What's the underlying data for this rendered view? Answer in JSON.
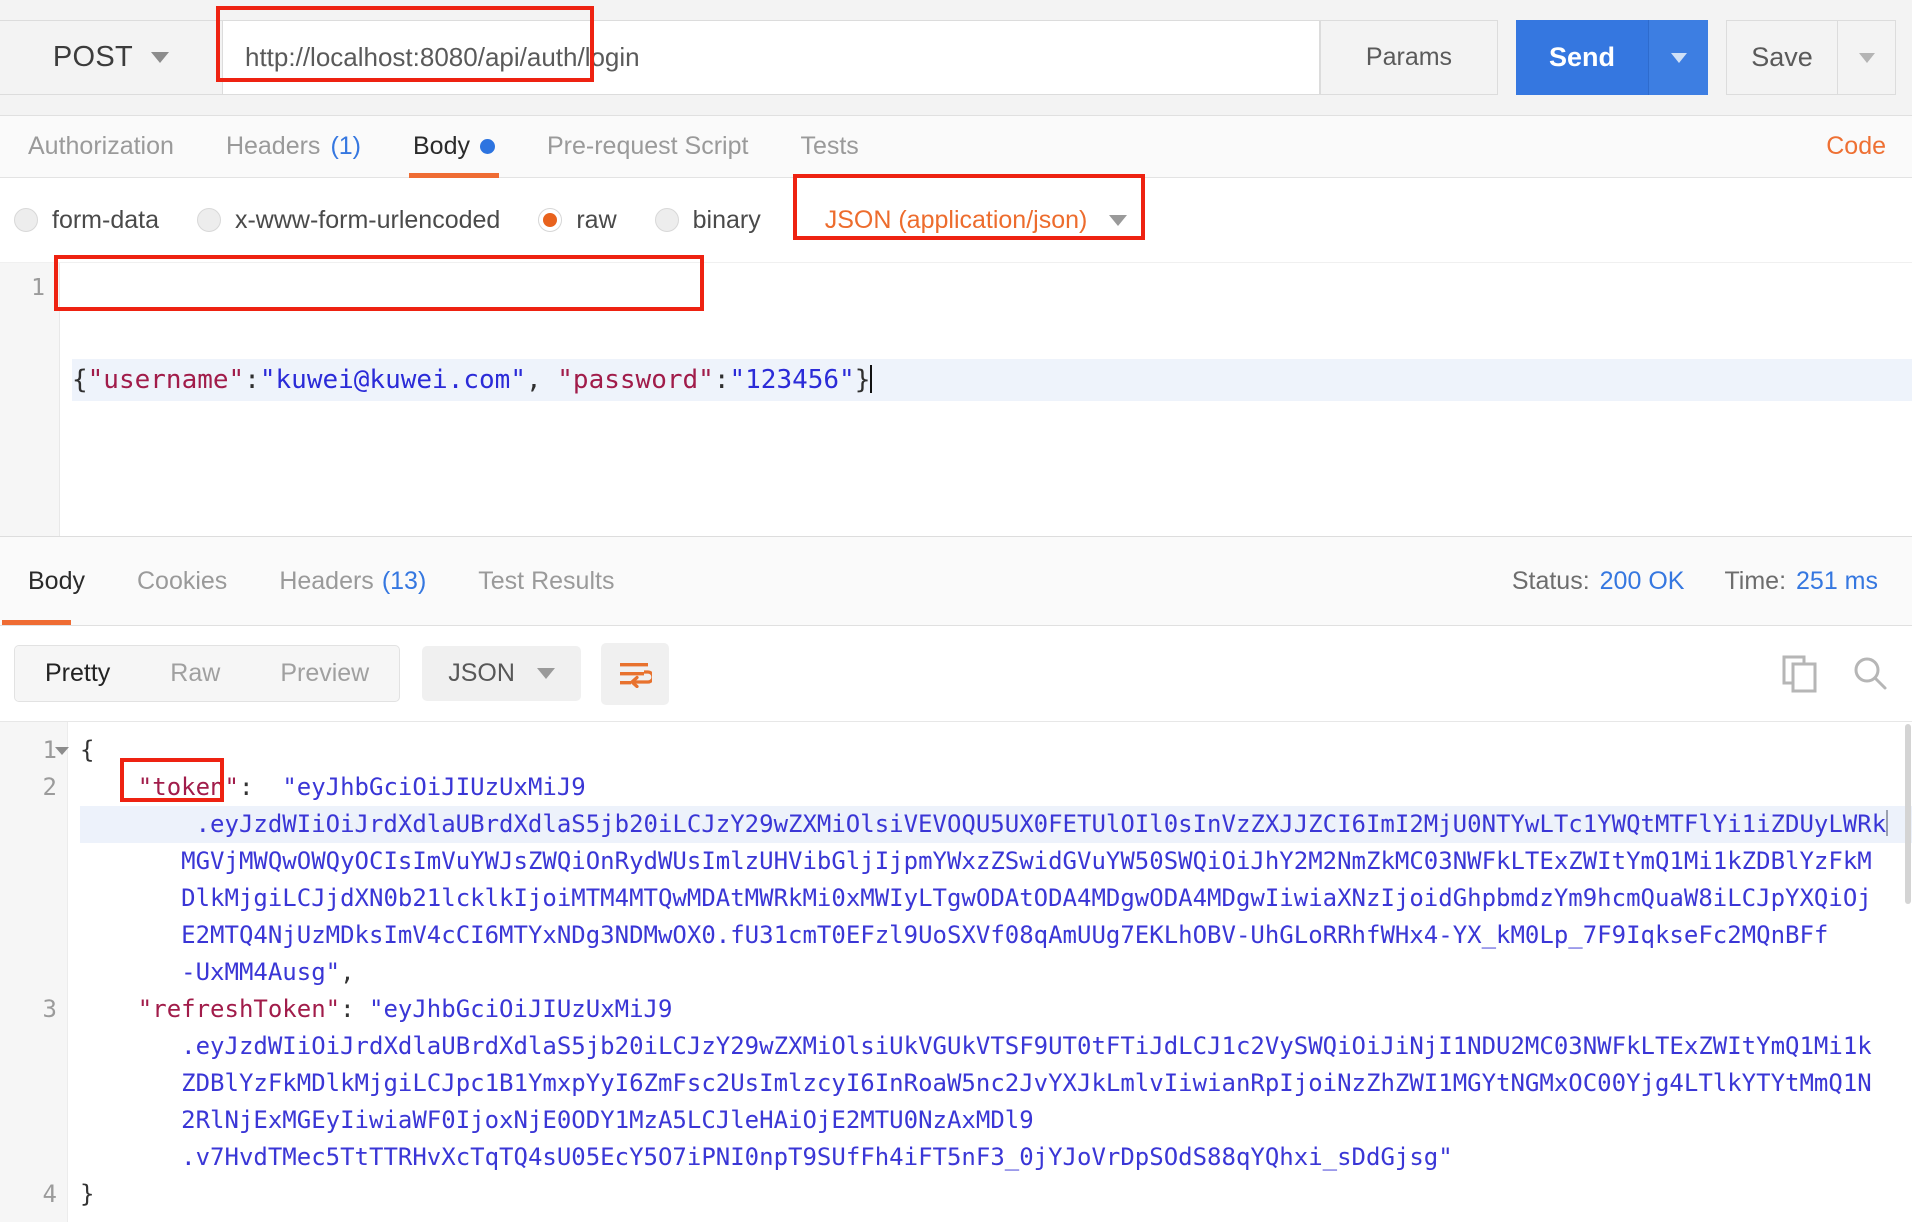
{
  "request": {
    "method": "POST",
    "url": "http://localhost:8080/api/auth/login",
    "params_label": "Params",
    "send_label": "Send",
    "save_label": "Save",
    "tabs": [
      {
        "label": "Authorization",
        "count": "",
        "active": false,
        "dot": false
      },
      {
        "label": "Headers",
        "count": "(1)",
        "active": false,
        "dot": false
      },
      {
        "label": "Body",
        "count": "",
        "active": true,
        "dot": true
      },
      {
        "label": "Pre-request Script",
        "count": "",
        "active": false,
        "dot": false
      },
      {
        "label": "Tests",
        "count": "",
        "active": false,
        "dot": false
      }
    ],
    "code_link": "Code",
    "body_types": [
      {
        "label": "form-data",
        "selected": false
      },
      {
        "label": "x-www-form-urlencoded",
        "selected": false
      },
      {
        "label": "raw",
        "selected": true
      },
      {
        "label": "binary",
        "selected": false
      }
    ],
    "content_type": "JSON (application/json)",
    "editor": {
      "line_number": "1",
      "open_brace": "{",
      "key_username": "\"username\"",
      "colon1": ":",
      "val_username": "\"kuwei@kuwei.com\"",
      "comma": ", ",
      "key_password": "\"password\"",
      "colon2": ":",
      "val_password": "\"123456\"",
      "close_brace": "}"
    }
  },
  "response": {
    "tabs": [
      {
        "label": "Body",
        "count": "",
        "active": true
      },
      {
        "label": "Cookies",
        "count": "",
        "active": false
      },
      {
        "label": "Headers",
        "count": "(13)",
        "active": false
      },
      {
        "label": "Test Results",
        "count": "",
        "active": false
      }
    ],
    "status_label": "Status:",
    "status_value": "200 OK",
    "time_label": "Time:",
    "time_value": "251 ms",
    "view_modes": [
      {
        "label": "Pretty",
        "active": true
      },
      {
        "label": "Raw",
        "active": false
      },
      {
        "label": "Preview",
        "active": false
      }
    ],
    "format": "JSON",
    "wrap_icon": "word-wrap-icon",
    "copy_icon": "copy-icon",
    "search_icon": "search-icon",
    "gutter": [
      "1",
      "2",
      "",
      "",
      "",
      "",
      "",
      "3",
      "",
      "",
      "",
      "",
      "4"
    ],
    "lines": [
      {
        "n": "1",
        "fold": true,
        "segments": [
          {
            "t": "punc",
            "v": "{"
          }
        ]
      },
      {
        "n": "2",
        "fold": false,
        "segments": [
          {
            "t": "indent",
            "v": "    "
          },
          {
            "t": "key",
            "v": "\"token\""
          },
          {
            "t": "punc",
            "v": ":"
          },
          {
            "t": "indent",
            "v": "  "
          },
          {
            "t": "str",
            "v": "\"eyJhbGciOiJIUzUxMiJ9"
          }
        ]
      },
      {
        "n": "",
        "fold": false,
        "selected": true,
        "segments": [
          {
            "t": "indent",
            "v": "        "
          },
          {
            "t": "str",
            "v": ".eyJzdWIiOiJrdXdlaUBrdXdlaS5jb20iLCJzY29wZXMiOlsiVEVOQU5UX0FETUlOIl0sInVzZXJJZCI6ImI2MjU0NTYwLTc1YWQtMTFlYi1iZDUyLWRk"
          },
          {
            "t": "caret",
            "v": ""
          }
        ]
      },
      {
        "n": "",
        "fold": false,
        "segments": [
          {
            "t": "indent",
            "v": "       "
          },
          {
            "t": "str",
            "v": "MGVjMWQwOWQyOCIsImVuYWJsZWQiOnRydWUsImlzUHVibGljIjpmYWxzZSwidGVuYW50SWQiOiJhY2M2NmZkMC03NWFkLTExZWItYmQ1Mi1kZDBlYzFkM"
          }
        ]
      },
      {
        "n": "",
        "fold": false,
        "segments": [
          {
            "t": "indent",
            "v": "       "
          },
          {
            "t": "str",
            "v": "DlkMjgiLCJjdXN0b21lcklkIjoiMTM4MTQwMDAtMWRkMi0xMWIyLTgwODAtODA4MDgwODA4MDgwIiwiaXNzIjoidGhpbmdzYm9hcmQuaW8iLCJpYXQiOj"
          }
        ]
      },
      {
        "n": "",
        "fold": false,
        "segments": [
          {
            "t": "indent",
            "v": "       "
          },
          {
            "t": "str",
            "v": "E2MTQ4NjUzMDksImV4cCI6MTYxNDg3NDMwOX0.fU31cmT0EFzl9UoSXVf08qAmUUg7EKLhOBV-UhGLoRRhfWHx4-YX_kM0Lp_7F9IqkseFc2MQnBFf"
          }
        ]
      },
      {
        "n": "",
        "fold": false,
        "segments": [
          {
            "t": "indent",
            "v": "       "
          },
          {
            "t": "str",
            "v": "-UxMM4Ausg\""
          },
          {
            "t": "punc",
            "v": ","
          }
        ]
      },
      {
        "n": "3",
        "fold": false,
        "segments": [
          {
            "t": "indent",
            "v": "    "
          },
          {
            "t": "key",
            "v": "\"refreshToken\""
          },
          {
            "t": "punc",
            "v": ":"
          },
          {
            "t": "indent",
            "v": " "
          },
          {
            "t": "str",
            "v": "\"eyJhbGciOiJIUzUxMiJ9"
          }
        ]
      },
      {
        "n": "",
        "fold": false,
        "segments": [
          {
            "t": "indent",
            "v": "       "
          },
          {
            "t": "str",
            "v": ".eyJzdWIiOiJrdXdlaUBrdXdlaS5jb20iLCJzY29wZXMiOlsiUkVGUkVTSF9UT0tFTiJdLCJ1c2VySWQiOiJiNjI1NDU2MC03NWFkLTExZWItYmQ1Mi1k"
          }
        ]
      },
      {
        "n": "",
        "fold": false,
        "segments": [
          {
            "t": "indent",
            "v": "       "
          },
          {
            "t": "str",
            "v": "ZDBlYzFkMDlkMjgiLCJpc1B1YmxpYyI6ZmFsc2UsImlzcyI6InRoaW5nc2JvYXJkLmlvIiwianRpIjoiNzZhZWI1MGYtNGMxOC00Yjg4LTlkYTYtMmQ1N"
          }
        ]
      },
      {
        "n": "",
        "fold": false,
        "segments": [
          {
            "t": "indent",
            "v": "       "
          },
          {
            "t": "str",
            "v": "2RlNjExMGEyIiwiaWF0IjoxNjE0ODY1MzA5LCJleHAiOjE2MTU0NzAxMDl9"
          }
        ]
      },
      {
        "n": "",
        "fold": false,
        "segments": [
          {
            "t": "indent",
            "v": "       "
          },
          {
            "t": "str",
            "v": ".v7HvdTMec5TtTTRHvXcTqTQ4sU05EcY5O7iPNI0npT9SUfFh4iFT5nF3_0jYJoVrDpSOdS88qYQhxi_sDdGjsg\""
          }
        ]
      },
      {
        "n": "4",
        "fold": false,
        "segments": [
          {
            "t": "punc",
            "v": "}"
          }
        ]
      }
    ]
  },
  "colors": {
    "accent_orange": "#ef6c33",
    "link_blue": "#3577e0",
    "send_blue": "#3577e0",
    "highlight_red": "#ee2211",
    "json_key": "#a11c4a",
    "json_string": "#3a36d6"
  }
}
